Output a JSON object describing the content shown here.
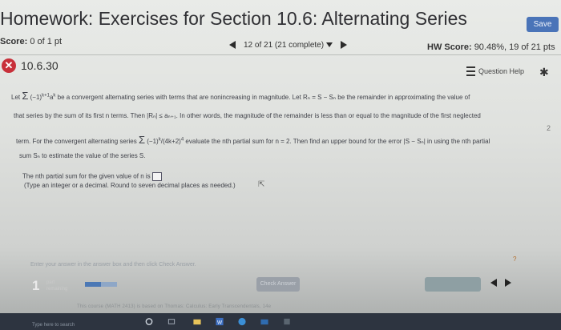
{
  "header": {
    "title": "Homework: Exercises for Section 10.6: Alternating Series",
    "save_label": "Save"
  },
  "status": {
    "score_label": "Score:",
    "score_value": "0 of 1 pt",
    "nav_label": "12 of 21 (21 complete)",
    "hw_score_label": "HW Score:",
    "hw_score_value": "90.48%, 19 of 21 pts"
  },
  "question": {
    "id": "10.6.30",
    "help_label": "Question Help",
    "line1": "be a convergent alternating series with terms that are nonincreasing in magnitude. Let Rₙ = S − Sₙ be the remainder in approximating the value of",
    "line2a": "that series by the sum of its first n terms. Then |Rₙ| ≤ aₙ₊₁. In other words, the magnitude of the remainder is less than or equal to the magnitude of the first neglected",
    "line3": "evaluate the nth partial sum for n = 2. Then find an upper bound for the error |S − Sₙ| in using the nth partial",
    "line3_prefix": "term. For the convergent alternating series",
    "line4": "sum Sₙ to estimate the value of the series S.",
    "answer_prompt": "The nth partial sum for the given value of n is",
    "instructions": "(Type an integer or a decimal. Round to seven decimal places as needed.)",
    "let_label": "Let",
    "side_number": "2"
  },
  "answer_area": {
    "hint": "Enter your answer in the answer box and then click Check Answer.",
    "parts_count": "1",
    "parts_sub1": "part",
    "parts_sub2": "remaining",
    "check_label": "Check Answer",
    "progress": 0.5
  },
  "footer": {
    "text": "This course (MATH 2413) is based on Thomas: Calculus: Early Transcendentals, 14e"
  },
  "taskbar": {
    "search_label": "Type here to search"
  }
}
